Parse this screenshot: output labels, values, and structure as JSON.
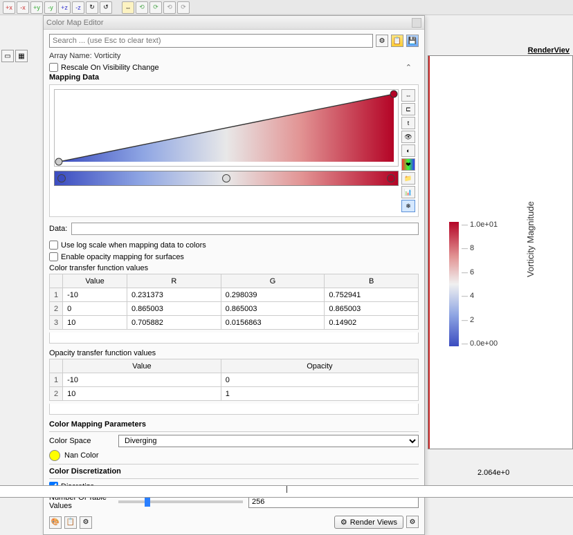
{
  "toolbar": {
    "btns": [
      "+x",
      "-x",
      "+y",
      "-y",
      "+z",
      "-z"
    ]
  },
  "window": {
    "title": "Color Map Editor"
  },
  "search": {
    "placeholder": "Search ... (use Esc to clear text)"
  },
  "array_name_label": "Array Name:",
  "array_name_value": "Vorticity",
  "rescale_label": "Rescale On Visibility Change",
  "mapping_label": "Mapping Data",
  "color_handles": [
    0,
    50,
    100
  ],
  "data_label": "Data:",
  "log_scale_label": "Use log scale when mapping data to colors",
  "opacity_surf_label": "Enable opacity mapping for surfaces",
  "ctf_label": "Color transfer function values",
  "ctf_headers": [
    "Value",
    "R",
    "G",
    "B"
  ],
  "ctf_rows": [
    {
      "idx": "1",
      "value": "-10",
      "r": "0.231373",
      "g": "0.298039",
      "b": "0.752941"
    },
    {
      "idx": "2",
      "value": "0",
      "r": "0.865003",
      "g": "0.865003",
      "b": "0.865003"
    },
    {
      "idx": "3",
      "value": "10",
      "r": "0.705882",
      "g": "0.0156863",
      "b": "0.14902"
    }
  ],
  "otf_label": "Opacity transfer function values",
  "otf_headers": [
    "Value",
    "Opacity"
  ],
  "otf_rows": [
    {
      "idx": "1",
      "value": "-10",
      "op": "0"
    },
    {
      "idx": "2",
      "value": "10",
      "op": "1"
    }
  ],
  "cmp_label": "Color Mapping Parameters",
  "color_space_label": "Color Space",
  "color_space_value": "Diverging",
  "nan_label": "Nan Color",
  "cd_label": "Color Discretization",
  "discretize_label": "Discretize",
  "ntv_label": "Number Of Table Values",
  "ntv_value": "256",
  "render_btn": "Render Views",
  "view": {
    "label": "RenderViev",
    "legend_title": "Vorticity Magnitude",
    "ticks": [
      "1.0e+01",
      "8",
      "6",
      "4",
      "2",
      "0.0e+00"
    ],
    "axis_value": "2.064e+0"
  }
}
